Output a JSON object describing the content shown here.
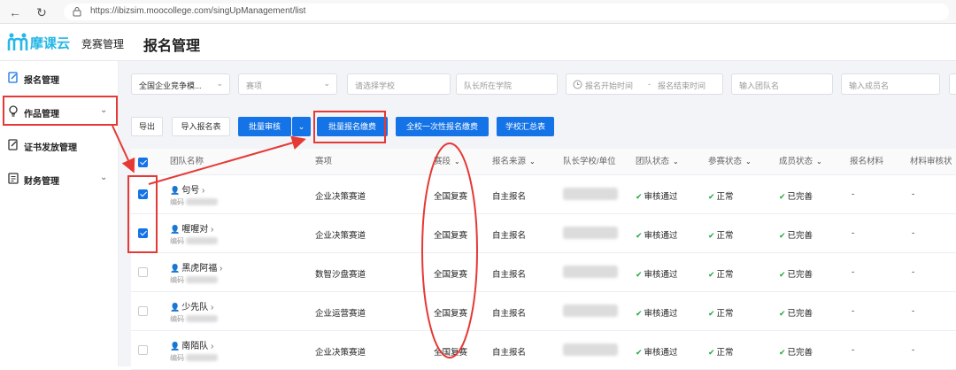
{
  "browser": {
    "url": "https://ibizsim.moocollege.com/singUpManagement/list"
  },
  "header": {
    "logo_text": "摩课云",
    "section": "竞赛管理",
    "title": "报名管理"
  },
  "sidebar": {
    "items": [
      {
        "label": "报名管理",
        "icon": "edit-icon",
        "chevron": ""
      },
      {
        "label": "作品管理",
        "icon": "bulb-icon",
        "chevron": "⌄"
      },
      {
        "label": "证书发放管理",
        "icon": "edit-icon",
        "chevron": ""
      },
      {
        "label": "财务管理",
        "icon": "doc-icon",
        "chevron": "⌄"
      }
    ]
  },
  "filters": {
    "competition": "全国企业竞争模...",
    "track": "赛项",
    "school": "请选择学校",
    "leader_school": "队长所在学院",
    "date_start": "报名开始时间",
    "date_sep": "-",
    "date_end": "报名结束时间",
    "team_name": "输入团队名",
    "member_name": "输入成员名"
  },
  "actions": {
    "export": "导出",
    "import": "导入报名表",
    "batch_review": "批量审核",
    "batch_review_more": "⌄",
    "batch_fee": "批量报名缴费",
    "school_fee": "全校一次性报名缴费",
    "school_summary": "学校汇总表"
  },
  "table": {
    "columns": [
      "团队名称",
      "赛项",
      "赛段",
      "报名来源",
      "队长学校/单位",
      "团队状态",
      "参赛状态",
      "成员状态",
      "报名材料",
      "材料审核状"
    ],
    "rows": [
      {
        "checked": true,
        "team": "句号",
        "code": "编码",
        "track": "企业决策赛道",
        "stage": "全国复赛",
        "source": "自主报名",
        "team_status": "审核通过",
        "compete_status": "正常",
        "member_status": "已完善",
        "materials": "-",
        "material_review": "-"
      },
      {
        "checked": true,
        "team": "喔喔对",
        "code": "编码",
        "track": "企业决策赛道",
        "stage": "全国复赛",
        "source": "自主报名",
        "team_status": "审核通过",
        "compete_status": "正常",
        "member_status": "已完善",
        "materials": "-",
        "material_review": "-"
      },
      {
        "checked": false,
        "team": "黑虎阿福",
        "code": "编码",
        "track": "数智沙盘赛道",
        "stage": "全国复赛",
        "source": "自主报名",
        "team_status": "审核通过",
        "compete_status": "正常",
        "member_status": "已完善",
        "materials": "-",
        "material_review": "-"
      },
      {
        "checked": false,
        "team": "少先队",
        "code": "编码",
        "track": "企业运营赛道",
        "stage": "全国复赛",
        "source": "自主报名",
        "team_status": "审核通过",
        "compete_status": "正常",
        "member_status": "已完善",
        "materials": "-",
        "material_review": "-"
      },
      {
        "checked": false,
        "team": "南陌队",
        "code": "编码",
        "track": "企业决策赛道",
        "stage": "全国复赛",
        "source": "自主报名",
        "team_status": "审核通过",
        "compete_status": "正常",
        "member_status": "已完善",
        "materials": "-",
        "material_review": "-"
      }
    ]
  },
  "colors": {
    "accent": "#1473e6",
    "annotation": "#e53935",
    "logo": "#25b7e6",
    "success": "#1fa83a"
  }
}
